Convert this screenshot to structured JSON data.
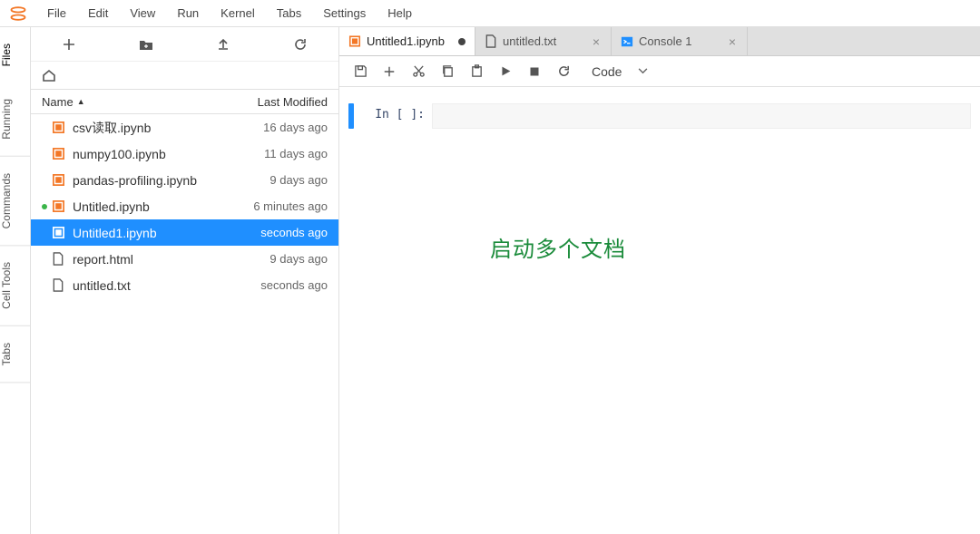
{
  "menu": {
    "items": [
      "File",
      "Edit",
      "View",
      "Run",
      "Kernel",
      "Tabs",
      "Settings",
      "Help"
    ]
  },
  "leftRail": {
    "tabs": [
      "Files",
      "Running",
      "Commands",
      "Cell Tools",
      "Tabs"
    ],
    "activeIndex": 0
  },
  "fileToolbar": {
    "newLauncher": "+",
    "newFolder": "folder",
    "upload": "upload",
    "refresh": "refresh"
  },
  "breadcrumb": {
    "home": "home"
  },
  "fileHeader": {
    "name": "Name",
    "lastModified": "Last Modified"
  },
  "files": [
    {
      "name": "csv读取.ipynb",
      "modified": "16 days ago",
      "icon": "notebook",
      "running": false,
      "selected": false
    },
    {
      "name": "numpy100.ipynb",
      "modified": "11 days ago",
      "icon": "notebook",
      "running": false,
      "selected": false
    },
    {
      "name": "pandas-profiling.ipynb",
      "modified": "9 days ago",
      "icon": "notebook",
      "running": false,
      "selected": false
    },
    {
      "name": "Untitled.ipynb",
      "modified": "6 minutes ago",
      "icon": "notebook",
      "running": true,
      "selected": false
    },
    {
      "name": "Untitled1.ipynb",
      "modified": "seconds ago",
      "icon": "notebook",
      "running": false,
      "selected": true
    },
    {
      "name": "report.html",
      "modified": "9 days ago",
      "icon": "file",
      "running": false,
      "selected": false
    },
    {
      "name": "untitled.txt",
      "modified": "seconds ago",
      "icon": "file",
      "running": false,
      "selected": false
    }
  ],
  "tabs": [
    {
      "label": "Untitled1.ipynb",
      "icon": "notebook",
      "dirty": true,
      "active": true
    },
    {
      "label": "untitled.txt",
      "icon": "text",
      "dirty": false,
      "active": false
    },
    {
      "label": "Console 1",
      "icon": "console",
      "dirty": false,
      "active": false
    }
  ],
  "nbToolbar": {
    "cellType": "Code"
  },
  "cellPrompt": "In [ ]:",
  "annotation": "启动多个文档",
  "colors": {
    "accent": "#f37726",
    "selection": "#1f8fff",
    "annotation": "#1a8b3a"
  }
}
